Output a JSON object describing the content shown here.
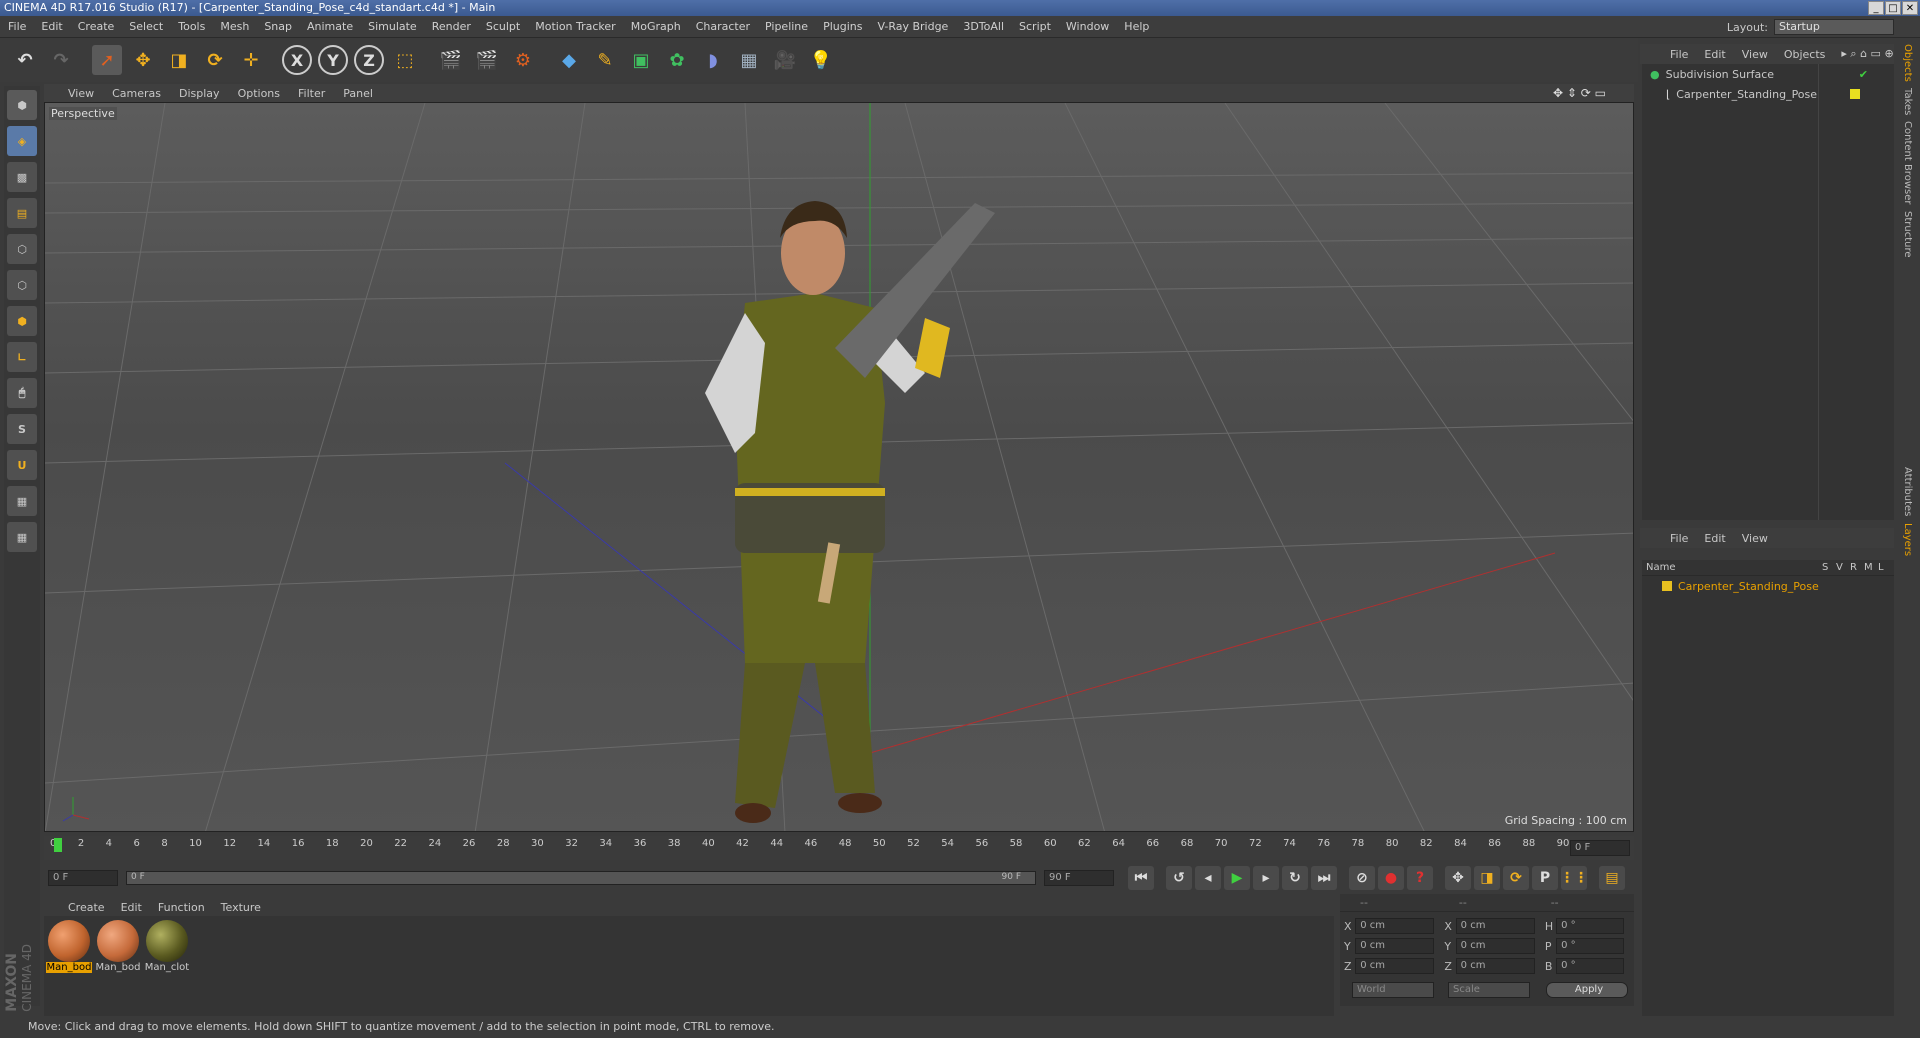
{
  "window": {
    "title": "CINEMA 4D R17.016 Studio (R17) - [Carpenter_Standing_Pose_c4d_standart.c4d *] - Main"
  },
  "menu": [
    "File",
    "Edit",
    "Create",
    "Select",
    "Tools",
    "Mesh",
    "Snap",
    "Animate",
    "Simulate",
    "Render",
    "Sculpt",
    "Motion Tracker",
    "MoGraph",
    "Character",
    "Pipeline",
    "Plugins",
    "V-Ray Bridge",
    "3DToAll",
    "Script",
    "Window",
    "Help"
  ],
  "layout": {
    "label": "Layout:",
    "value": "Startup"
  },
  "viewport": {
    "menu": [
      "View",
      "Cameras",
      "Display",
      "Options",
      "Filter",
      "Panel"
    ],
    "label": "Perspective",
    "grid_spacing": "Grid Spacing : 100 cm"
  },
  "timeline": {
    "ticks": [
      "0",
      "2",
      "4",
      "6",
      "8",
      "10",
      "12",
      "14",
      "16",
      "18",
      "20",
      "22",
      "24",
      "26",
      "28",
      "30",
      "32",
      "34",
      "36",
      "38",
      "40",
      "42",
      "44",
      "46",
      "48",
      "50",
      "52",
      "54",
      "56",
      "58",
      "60",
      "62",
      "64",
      "66",
      "68",
      "70",
      "72",
      "74",
      "76",
      "78",
      "80",
      "82",
      "84",
      "86",
      "88",
      "90"
    ],
    "current_frame": "0 F",
    "start": "0 F",
    "range_start": "0 F",
    "range_end": "90 F",
    "end": "90 F"
  },
  "materials": {
    "menu": [
      "Create",
      "Edit",
      "Function",
      "Texture"
    ],
    "items": [
      {
        "name": "Man_bod",
        "selected": true,
        "color": "#c0642e"
      },
      {
        "name": "Man_bod",
        "selected": false,
        "color": "#c56a3a"
      },
      {
        "name": "Man_clot",
        "selected": false,
        "color": "#5a5a20"
      }
    ]
  },
  "coords": {
    "rows": [
      {
        "a1": "X",
        "v1": "0 cm",
        "a2": "X",
        "v2": "0 cm",
        "a3": "H",
        "v3": "0 °"
      },
      {
        "a1": "Y",
        "v1": "0 cm",
        "a2": "Y",
        "v2": "0 cm",
        "a3": "P",
        "v3": "0 °"
      },
      {
        "a1": "Z",
        "v1": "0 cm",
        "a2": "Z",
        "v2": "0 cm",
        "a3": "B",
        "v3": "0 °"
      }
    ],
    "mode": "World",
    "scale": "Scale",
    "apply": "Apply"
  },
  "objects_panel": {
    "menu": [
      "File",
      "Edit",
      "View",
      "Objects"
    ],
    "items": [
      "Subdivision Surface",
      "Carpenter_Standing_Pose"
    ]
  },
  "layers_panel": {
    "menu": [
      "File",
      "Edit",
      "View"
    ],
    "cols": {
      "name": "Name",
      "s": "S",
      "v": "V",
      "r": "R",
      "m": "M",
      "l": "L"
    },
    "items": [
      "Carpenter_Standing_Pose"
    ]
  },
  "side_tabs": [
    "Objects",
    "Takes",
    "Content Browser",
    "Structure",
    "Attributes",
    "Layers"
  ],
  "status": "Move: Click and drag to move elements. Hold down SHIFT to quantize movement / add to the selection in point mode, CTRL to remove.",
  "brand": {
    "line1": "MAXON",
    "line2": "CINEMA 4D"
  }
}
